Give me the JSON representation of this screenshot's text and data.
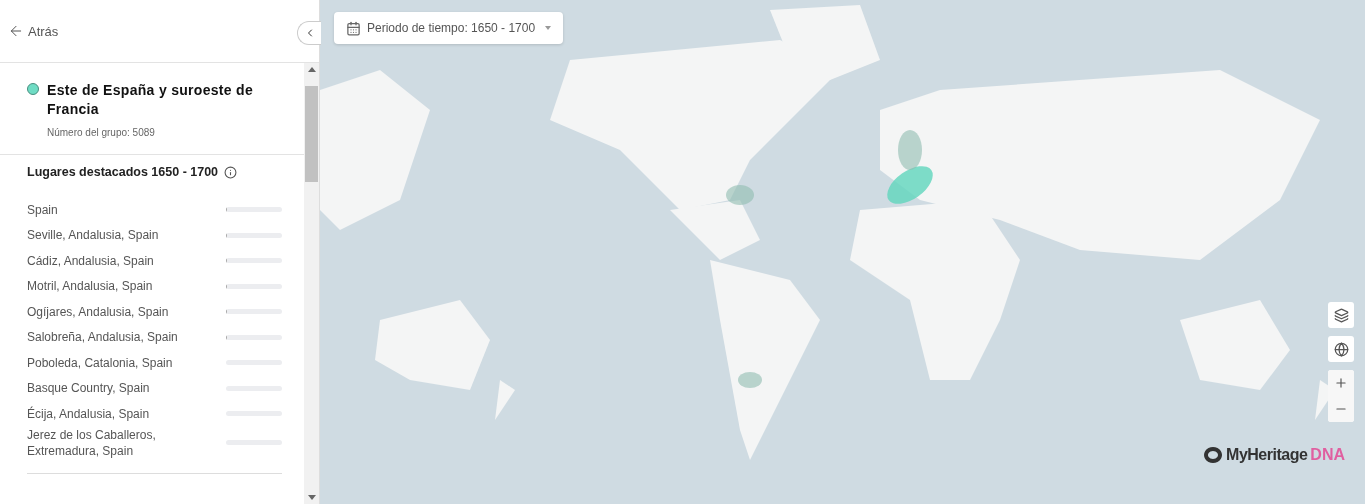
{
  "header": {
    "back": "Atrás"
  },
  "group": {
    "title": "Este de España y suroeste de Francia",
    "color": "#6fdcc4",
    "number": "Número del grupo: 5089"
  },
  "places": {
    "title": "Lugares destacados 1650 - 1700",
    "items": [
      {
        "name": "Spain",
        "level": 0.02
      },
      {
        "name": "Seville, Andalusia, Spain",
        "level": 0.01
      },
      {
        "name": "Cádiz, Andalusia, Spain",
        "level": 0.01
      },
      {
        "name": "Motril, Andalusia, Spain",
        "level": 0.01
      },
      {
        "name": "Ogíjares, Andalusia, Spain",
        "level": 0.01
      },
      {
        "name": "Salobreña, Andalusia, Spain",
        "level": 0.01
      },
      {
        "name": "Poboleda, Catalonia, Spain",
        "level": 0
      },
      {
        "name": "Basque Country, Spain",
        "level": 0
      },
      {
        "name": "Écija, Andalusia, Spain",
        "level": 0
      },
      {
        "name": "Jerez de los Caballeros, Extremadura, Spain",
        "level": 0
      }
    ]
  },
  "period": {
    "label": "Periodo de tiempo: 1650 - 1700"
  },
  "logo": {
    "name": "MyHeritage",
    "suffix": "DNA"
  }
}
